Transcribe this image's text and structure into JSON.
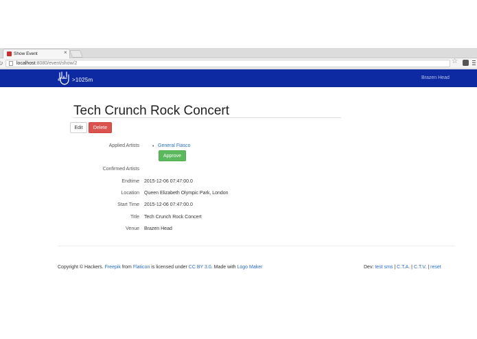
{
  "browser": {
    "tab_title": "Show Event",
    "tab_close": "×",
    "url_host": "localhost",
    "url_path": ":8080/event/show/2"
  },
  "navbar": {
    "brand_text": ">1025m",
    "right_link": "Brazen Head"
  },
  "event": {
    "title": "Tech Crunch Rock Concert",
    "edit_label": "Edit",
    "delete_label": "Delete",
    "applied_label": "Applied Artists",
    "applied_artists": [
      "General Fiasco"
    ],
    "approve_label": "Approve",
    "confirmed_label": "Confirmed Artists",
    "fields": [
      {
        "label": "Endtime",
        "value": "2015-12-06 07:47:00.0"
      },
      {
        "label": "Location",
        "value": "Queen Elizabeth Olympic Park, London"
      },
      {
        "label": "Start Time",
        "value": "2015-12-06 07:47:00.0"
      },
      {
        "label": "Title",
        "value": "Tech Crunch Rock Concert"
      },
      {
        "label": "Venue",
        "value": "Brazen Head"
      }
    ]
  },
  "footer": {
    "copyright": "Copyright © Hackers.",
    "freepik": "Freepik",
    "from": "from",
    "flaticon": "Flaticon",
    "licensed": "is licensed under",
    "cc": "CC BY 3.0",
    "made_with": ". Made with",
    "logo_maker": "Logo Maker",
    "dev_label": "Dev:",
    "test_sms": "test sms",
    "cta": "C.T.A.",
    "ctv": "C.T.V.",
    "reset": "reset",
    "sep": "|"
  },
  "colors": {
    "navbar": "#0d2aa3",
    "danger": "#d9534f",
    "success": "#5cb85c",
    "link": "#2a6fc9"
  },
  "icons": {
    "brand": "rock-hand-icon",
    "bookmark": "star-icon"
  }
}
